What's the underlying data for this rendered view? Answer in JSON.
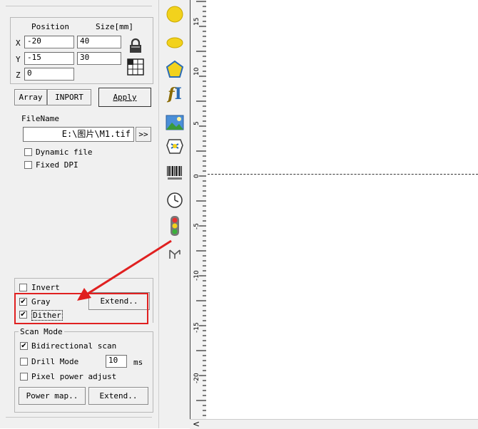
{
  "position_group": {
    "position_label": "Position",
    "size_label": "Size[mm]",
    "x_label": "X",
    "y_label": "Y",
    "z_label": "Z",
    "x_position": "-20",
    "x_size": "40",
    "y_position": "-15",
    "y_size": "30",
    "z_position": "0"
  },
  "buttons": {
    "array": "Array",
    "import": "INPORT",
    "apply": "Apply",
    "browse": ">>",
    "extend_gray": "Extend..",
    "power_map": "Power map..",
    "extend_scan": "Extend.."
  },
  "file": {
    "label": "FileName",
    "value": "E:\\图片\\M1.tif",
    "dynamic_file": "Dynamic file",
    "fixed_dpi": "Fixed DPI"
  },
  "image_options": {
    "invert": "Invert",
    "gray": "Gray",
    "dither": "Dither",
    "invert_checked": false,
    "gray_checked": true,
    "dither_checked": true
  },
  "scan_mode": {
    "title": "Scan Mode",
    "bidirectional": "Bidirectional scan",
    "drill_mode": "Drill Mode",
    "drill_value": "10",
    "drill_unit": "ms",
    "pixel_power": "Pixel power adjust"
  },
  "ruler": {
    "labels": [
      "15",
      "10",
      "5",
      "0",
      "-5",
      "-10",
      "-15",
      "-20"
    ]
  },
  "toolbar_icons": [
    "circle-icon",
    "ellipse-icon",
    "polygon-icon",
    "text-icon",
    "image-icon",
    "vector-file-icon",
    "barcode-icon",
    "clock-icon",
    "traffic-light-icon",
    "input-icon"
  ],
  "scroll": {
    "left_arrow": "<"
  },
  "colors": {
    "highlight": "#e02020",
    "marker_yellow": "#f2d21c"
  }
}
